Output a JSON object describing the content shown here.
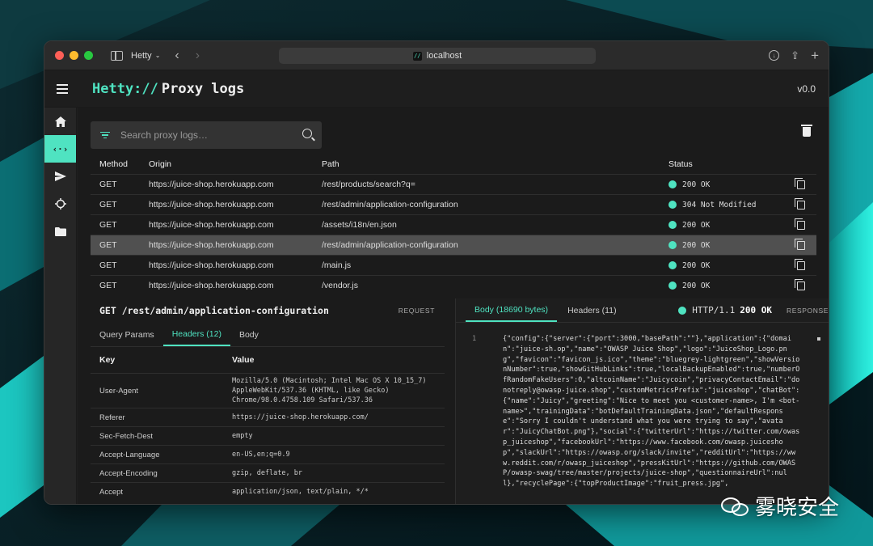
{
  "browser": {
    "tab_title": "Hetty",
    "url": "localhost",
    "favicon_text": "//"
  },
  "app": {
    "brand": "Hetty://",
    "page_title": "Proxy logs",
    "version": "v0.0"
  },
  "nav": {
    "items": [
      {
        "icon": "home-icon"
      },
      {
        "icon": "code-icon",
        "active": true
      },
      {
        "icon": "send-icon"
      },
      {
        "icon": "crosshair-icon"
      },
      {
        "icon": "folder-icon"
      }
    ]
  },
  "search": {
    "placeholder": "Search proxy logs…"
  },
  "table": {
    "headers": {
      "method": "Method",
      "origin": "Origin",
      "path": "Path",
      "status": "Status"
    },
    "rows": [
      {
        "method": "GET",
        "origin": "https://juice-shop.herokuapp.com",
        "path": "/rest/products/search?q=",
        "status": "200 OK"
      },
      {
        "method": "GET",
        "origin": "https://juice-shop.herokuapp.com",
        "path": "/rest/admin/application-configuration",
        "status": "304 Not Modified"
      },
      {
        "method": "GET",
        "origin": "https://juice-shop.herokuapp.com",
        "path": "/assets/i18n/en.json",
        "status": "200 OK"
      },
      {
        "method": "GET",
        "origin": "https://juice-shop.herokuapp.com",
        "path": "/rest/admin/application-configuration",
        "status": "200 OK",
        "selected": true
      },
      {
        "method": "GET",
        "origin": "https://juice-shop.herokuapp.com",
        "path": "/main.js",
        "status": "200 OK"
      },
      {
        "method": "GET",
        "origin": "https://juice-shop.herokuapp.com",
        "path": "/vendor.js",
        "status": "200 OK"
      }
    ]
  },
  "request": {
    "title": "GET /rest/admin/application-configuration",
    "label": "REQUEST",
    "tabs": [
      "Query Params",
      "Headers (12)",
      "Body"
    ],
    "active_tab": "Headers (12)",
    "kv_headers": {
      "key": "Key",
      "value": "Value"
    },
    "headers": [
      {
        "key": "User-Agent",
        "value": "Mozilla/5.0 (Macintosh; Intel Mac OS X 10_15_7) AppleWebKit/537.36 (KHTML, like Gecko) Chrome/98.0.4758.109 Safari/537.36"
      },
      {
        "key": "Referer",
        "value": "https://juice-shop.herokuapp.com/"
      },
      {
        "key": "Sec-Fetch-Dest",
        "value": "empty"
      },
      {
        "key": "Accept-Language",
        "value": "en-US,en;q=0.9"
      },
      {
        "key": "Accept-Encoding",
        "value": "gzip, deflate, br"
      },
      {
        "key": "Accept",
        "value": "application/json, text/plain, */*"
      }
    ]
  },
  "response": {
    "tabs": [
      "Body (18690 bytes)",
      "Headers (11)"
    ],
    "active_tab": "Body (18690 bytes)",
    "protocol": "HTTP/1.1",
    "status": "200 OK",
    "label": "RESPONSE",
    "line_number": "1",
    "body": "{\"config\":{\"server\":{\"port\":3000,\"basePath\":\"\"},\"application\":{\"domain\":\"juice-sh.op\",\"name\":\"OWASP Juice Shop\",\"logo\":\"JuiceShop_Logo.png\",\"favicon\":\"favicon_js.ico\",\"theme\":\"bluegrey-lightgreen\",\"showVersionNumber\":true,\"showGitHubLinks\":true,\"localBackupEnabled\":true,\"numberOfRandomFakeUsers\":0,\"altcoinName\":\"Juicycoin\",\"privacyContactEmail\":\"donotreply@owasp-juice.shop\",\"customMetricsPrefix\":\"juiceshop\",\"chatBot\":{\"name\":\"Juicy\",\"greeting\":\"Nice to meet you <customer-name>, I'm <bot-name>\",\"trainingData\":\"botDefaultTrainingData.json\",\"defaultResponse\":\"Sorry I couldn't understand what you were trying to say\",\"avatar\":\"JuicyChatBot.png\"},\"social\":{\"twitterUrl\":\"https://twitter.com/owasp_juiceshop\",\"facebookUrl\":\"https://www.facebook.com/owasp.juiceshop\",\"slackUrl\":\"https://owasp.org/slack/invite\",\"redditUrl\":\"https://www.reddit.com/r/owasp_juiceshop\",\"pressKitUrl\":\"https://github.com/OWASP/owasp-swag/tree/master/projects/juice-shop\",\"questionnaireUrl\":null},\"recyclePage\":{\"topProductImage\":\"fruit_press.jpg\","
  },
  "watermark": {
    "text": "雾晓安全"
  },
  "colors": {
    "accent": "#4fe3c1",
    "status_ok": "#4fe3c1"
  }
}
